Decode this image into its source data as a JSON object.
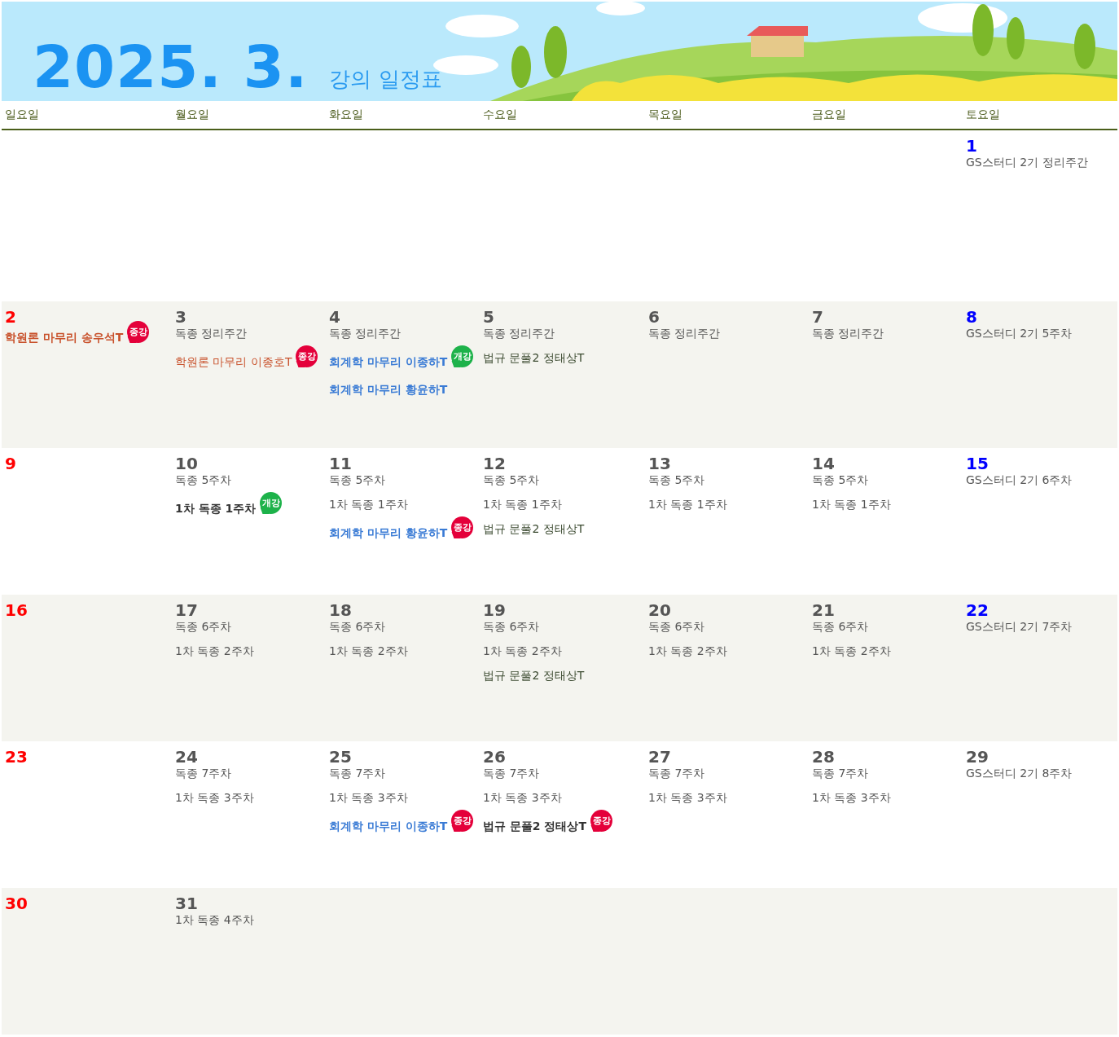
{
  "banner": {
    "title": "2025. 3.",
    "subtitle": "강의 일정표"
  },
  "weekdays": [
    "일요일",
    "월요일",
    "화요일",
    "수요일",
    "목요일",
    "금요일",
    "토요일"
  ],
  "weeks": [
    {
      "days": [
        {
          "date": "1",
          "color": "#0000ff",
          "events": [
            {
              "text": "GS스터디 2기 정리주간",
              "color": "#555555",
              "bold": false
            }
          ]
        }
      ]
    },
    {
      "days": [
        {
          "date": "2",
          "color": "#ff0000",
          "events": [
            {
              "text": "학원론 마무리 송우석T",
              "color": "#c8502a",
              "bold": true,
              "badge": {
                "text": "종강",
                "color": "#e4003a"
              }
            }
          ]
        },
        {
          "date": "3",
          "color": "#555555",
          "events": [
            {
              "text": "독종 정리주간",
              "color": "#555555",
              "bold": false
            },
            {
              "text": "학원론 마무리 이종호T",
              "color": "#c8502a",
              "bold": false,
              "badge": {
                "text": "종강",
                "color": "#e4003a"
              }
            }
          ]
        },
        {
          "date": "4",
          "color": "#555555",
          "events": [
            {
              "text": "독종 정리주간",
              "color": "#555555",
              "bold": false
            },
            {
              "text": "회계학 마무리 이종하T",
              "color": "#3a7bd5",
              "bold": true,
              "badge": {
                "text": "개강",
                "color": "#1db24a"
              }
            },
            {
              "text": "회계학 마무리 황윤하T",
              "color": "#3a7bd5",
              "bold": true
            }
          ]
        },
        {
          "date": "5",
          "color": "#555555",
          "events": [
            {
              "text": "독종 정리주간",
              "color": "#555555",
              "bold": false
            },
            {
              "text": "법규 문풀2 정태상T",
              "color": "#3b4a30",
              "bold": false
            }
          ]
        },
        {
          "date": "6",
          "color": "#555555",
          "events": [
            {
              "text": "독종 정리주간",
              "color": "#555555",
              "bold": false
            }
          ]
        },
        {
          "date": "7",
          "color": "#555555",
          "events": [
            {
              "text": "독종 정리주간",
              "color": "#555555",
              "bold": false
            }
          ]
        },
        {
          "date": "8",
          "color": "#0000ff",
          "events": [
            {
              "text": "GS스터디 2기 5주차",
              "color": "#555555",
              "bold": false
            }
          ]
        }
      ]
    },
    {
      "days": [
        {
          "date": "9",
          "color": "#ff0000"
        },
        {
          "date": "10",
          "color": "#555555",
          "events": [
            {
              "text": "독종 5주차",
              "color": "#555555",
              "bold": false
            },
            {
              "text": "1차 독종 1주차",
              "color": "#333333",
              "bold": true,
              "badge": {
                "text": "개강",
                "color": "#1db24a"
              }
            }
          ]
        },
        {
          "date": "11",
          "color": "#555555",
          "events": [
            {
              "text": "독종 5주차",
              "color": "#555555",
              "bold": false
            },
            {
              "text": "1차 독종 1주차",
              "color": "#555555",
              "bold": false
            },
            {
              "text": "회계학 마무리 황윤하T",
              "color": "#3a7bd5",
              "bold": true,
              "badge": {
                "text": "종강",
                "color": "#e4003a"
              }
            }
          ]
        },
        {
          "date": "12",
          "color": "#555555",
          "events": [
            {
              "text": "독종 5주차",
              "color": "#555555",
              "bold": false
            },
            {
              "text": "1차 독종 1주차",
              "color": "#555555",
              "bold": false
            },
            {
              "text": "법규 문풀2 정태상T",
              "color": "#3b4a30",
              "bold": false
            }
          ]
        },
        {
          "date": "13",
          "color": "#555555",
          "events": [
            {
              "text": "독종 5주차",
              "color": "#555555",
              "bold": false
            },
            {
              "text": "1차 독종 1주차",
              "color": "#555555",
              "bold": false
            }
          ]
        },
        {
          "date": "14",
          "color": "#555555",
          "events": [
            {
              "text": "독종 5주차",
              "color": "#555555",
              "bold": false
            },
            {
              "text": "1차 독종 1주차",
              "color": "#555555",
              "bold": false
            }
          ]
        },
        {
          "date": "15",
          "color": "#0000ff",
          "events": [
            {
              "text": "GS스터디 2기 6주차",
              "color": "#555555",
              "bold": false
            }
          ]
        }
      ]
    },
    {
      "days": [
        {
          "date": "16",
          "color": "#ff0000"
        },
        {
          "date": "17",
          "color": "#555555",
          "events": [
            {
              "text": "독종 6주차",
              "color": "#555555",
              "bold": false
            },
            {
              "text": "1차 독종 2주차",
              "color": "#555555",
              "bold": false
            }
          ]
        },
        {
          "date": "18",
          "color": "#555555",
          "events": [
            {
              "text": "독종 6주차",
              "color": "#555555",
              "bold": false
            },
            {
              "text": "1차 독종 2주차",
              "color": "#555555",
              "bold": false
            }
          ]
        },
        {
          "date": "19",
          "color": "#555555",
          "events": [
            {
              "text": "독종 6주차",
              "color": "#555555",
              "bold": false
            },
            {
              "text": "1차 독종 2주차",
              "color": "#555555",
              "bold": false
            },
            {
              "text": "법규 문풀2 정태상T",
              "color": "#3b4a30",
              "bold": false
            }
          ]
        },
        {
          "date": "20",
          "color": "#555555",
          "events": [
            {
              "text": "독종 6주차",
              "color": "#555555",
              "bold": false
            },
            {
              "text": "1차 독종 2주차",
              "color": "#555555",
              "bold": false
            }
          ]
        },
        {
          "date": "21",
          "color": "#555555",
          "events": [
            {
              "text": "독종 6주차",
              "color": "#555555",
              "bold": false
            },
            {
              "text": "1차 독종 2주차",
              "color": "#555555",
              "bold": false
            }
          ]
        },
        {
          "date": "22",
          "color": "#0000ff",
          "events": [
            {
              "text": "GS스터디 2기 7주차",
              "color": "#555555",
              "bold": false
            }
          ]
        }
      ]
    },
    {
      "days": [
        {
          "date": "23",
          "color": "#ff0000"
        },
        {
          "date": "24",
          "color": "#555555",
          "events": [
            {
              "text": "독종 7주차",
              "color": "#555555",
              "bold": false
            },
            {
              "text": "1차 독종 3주차",
              "color": "#555555",
              "bold": false
            }
          ]
        },
        {
          "date": "25",
          "color": "#555555",
          "events": [
            {
              "text": "독종 7주차",
              "color": "#555555",
              "bold": false
            },
            {
              "text": "1차 독종 3주차",
              "color": "#555555",
              "bold": false
            },
            {
              "text": "회계학 마무리 이종하T",
              "color": "#3a7bd5",
              "bold": true,
              "badge": {
                "text": "종강",
                "color": "#e4003a"
              }
            }
          ]
        },
        {
          "date": "26",
          "color": "#555555",
          "events": [
            {
              "text": "독종 7주차",
              "color": "#555555",
              "bold": false
            },
            {
              "text": "1차 독종 3주차",
              "color": "#555555",
              "bold": false
            },
            {
              "text": "법규 문풀2 정태상T",
              "color": "#333333",
              "bold": true,
              "badge": {
                "text": "종강",
                "color": "#e4003a"
              }
            }
          ]
        },
        {
          "date": "27",
          "color": "#555555",
          "events": [
            {
              "text": "독종 7주차",
              "color": "#555555",
              "bold": false
            },
            {
              "text": "1차 독종 3주차",
              "color": "#555555",
              "bold": false
            }
          ]
        },
        {
          "date": "28",
          "color": "#555555",
          "events": [
            {
              "text": "독종 7주차",
              "color": "#555555",
              "bold": false
            },
            {
              "text": "1차 독종 3주차",
              "color": "#555555",
              "bold": false
            }
          ]
        },
        {
          "date": "29",
          "color": "#555555",
          "events": [
            {
              "text": "GS스터디 2기 8주차",
              "color": "#555555",
              "bold": false
            }
          ]
        }
      ]
    },
    {
      "days": [
        {
          "date": "30",
          "color": "#ff0000"
        },
        {
          "date": "31",
          "color": "#555555",
          "events": [
            {
              "text": "1차 독종 4주차",
              "color": "#555555",
              "bold": false
            }
          ]
        }
      ]
    }
  ]
}
